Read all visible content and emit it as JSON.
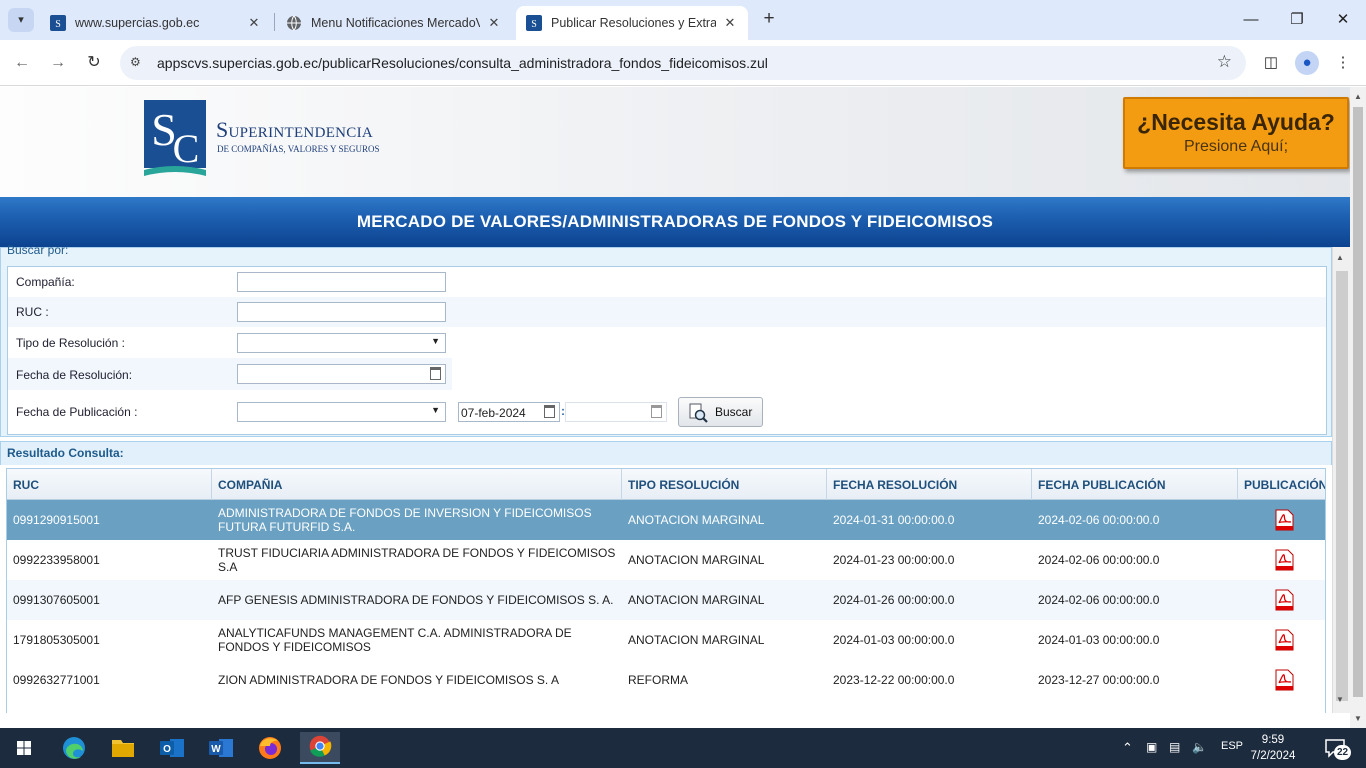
{
  "browser": {
    "tabs": [
      {
        "title": "www.supercias.gob.ec",
        "close": "✕"
      },
      {
        "title": "Menu Notificaciones MercadoV",
        "close": "✕"
      },
      {
        "title": "Publicar Resoluciones y Extractos",
        "close": "✕"
      }
    ],
    "new_tab": "+",
    "url": "appscvs.supercias.gob.ec/publicarResoluciones/consulta_administradora_fondos_fideicomisos.zul"
  },
  "header": {
    "logo_text": "Superintendencia",
    "logo_subtext": "DE COMPAÑÍAS, VALORES Y SEGUROS",
    "help_title": "¿Necesita Ayuda?",
    "help_sub": "Presione Aquí;"
  },
  "banner": {
    "title": "MERCADO DE VALORES/ADMINISTRADORAS DE FONDOS Y FIDEICOMISOS"
  },
  "search": {
    "panel_title": "Buscar por:",
    "compania_label": "Compañía:",
    "compania_value": "",
    "ruc_label": "RUC :",
    "ruc_value": "",
    "tipo_label": "Tipo de Resolución :",
    "tipo_value": "",
    "fecha_res_label": "Fecha de Resolución:",
    "fecha_res_value": "",
    "fecha_pub_label": "Fecha de Publicación :",
    "fecha_pub_select": "",
    "fecha_pub_from": "07-feb-2024",
    "fecha_pub_sep": ":",
    "fecha_pub_to": "",
    "search_button": "Buscar"
  },
  "results": {
    "title": "Resultado Consulta:",
    "columns": [
      "RUC",
      "COMPAÑIA",
      "TIPO RESOLUCIÓN",
      "FECHA RESOLUCIÓN",
      "FECHA PUBLICACIÓN",
      "PUBLICACIÓN"
    ],
    "rows": [
      {
        "ruc": "0991290915001",
        "compania": "ADMINISTRADORA DE FONDOS DE INVERSION Y FIDEICOMISOS FUTURA FUTURFID S.A.",
        "tipo": "ANOTACION MARGINAL",
        "fecha_res": "2024-01-31 00:00:00.0",
        "fecha_pub": "2024-02-06 00:00:00.0"
      },
      {
        "ruc": "0992233958001",
        "compania": "TRUST FIDUCIARIA ADMINISTRADORA DE FONDOS Y FIDEICOMISOS S.A",
        "tipo": "ANOTACION MARGINAL",
        "fecha_res": "2024-01-23 00:00:00.0",
        "fecha_pub": "2024-02-06 00:00:00.0"
      },
      {
        "ruc": "0991307605001",
        "compania": "AFP GENESIS ADMINISTRADORA DE FONDOS Y FIDEICOMISOS S. A.",
        "tipo": "ANOTACION MARGINAL",
        "fecha_res": "2024-01-26 00:00:00.0",
        "fecha_pub": "2024-02-06 00:00:00.0"
      },
      {
        "ruc": "1791805305001",
        "compania": "ANALYTICAFUNDS MANAGEMENT C.A. ADMINISTRADORA DE FONDOS Y FIDEICOMISOS",
        "tipo": "ANOTACION MARGINAL",
        "fecha_res": "2024-01-03 00:00:00.0",
        "fecha_pub": "2024-01-03 00:00:00.0"
      },
      {
        "ruc": "0992632771001",
        "compania": "ZION ADMINISTRADORA DE FONDOS Y FIDEICOMISOS S. A",
        "tipo": "REFORMA",
        "fecha_res": "2023-12-22 00:00:00.0",
        "fecha_pub": "2023-12-27 00:00:00.0"
      }
    ]
  },
  "taskbar": {
    "language": "ESP",
    "time": "9:59",
    "date": "7/2/2024",
    "notifications": "22"
  },
  "colors": {
    "banner": "#1d5fb1",
    "help_button": "#f39c12",
    "selected_row": "#6aa1c3",
    "taskbar": "#1c2b3d"
  }
}
